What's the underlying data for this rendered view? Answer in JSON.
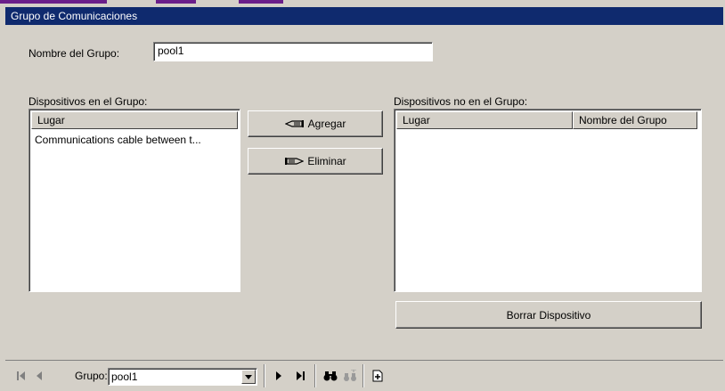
{
  "window": {
    "title": "Grupo de Comunicaciones"
  },
  "form": {
    "group_name_label": "Nombre del Grupo:",
    "group_name_value": "pool1"
  },
  "in_group": {
    "label": "Dispositivos en el Grupo:",
    "columns": [
      "Lugar"
    ],
    "rows": [
      "Communications cable between t..."
    ]
  },
  "buttons": {
    "add_label": "Agregar",
    "remove_label": "Eliminar",
    "delete_device_label": "Borrar Dispositivo"
  },
  "not_in_group": {
    "label": "Dispositivos no en el Grupo:",
    "columns": [
      "Lugar",
      "Nombre del Grupo"
    ],
    "rows": []
  },
  "navbar": {
    "group_label": "Grupo:",
    "group_value": "pool1"
  },
  "colors": {
    "titlebar": "#0f2a6e",
    "accent": "#6a1f8a",
    "background": "#d4d0c8"
  }
}
